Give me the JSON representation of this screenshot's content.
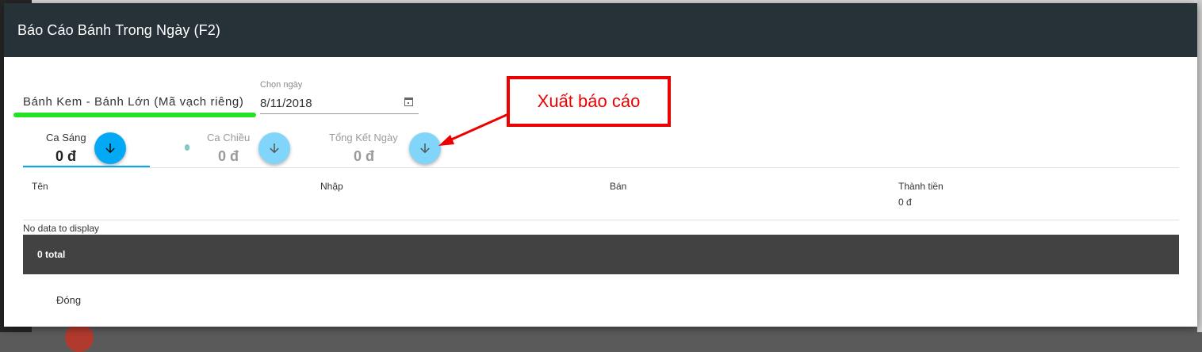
{
  "dialog": {
    "title": "Báo Cáo Bánh Trong Ngày (F2)"
  },
  "filters": {
    "product_group": "Bánh Kem - Bánh Lớn (Mã vạch riêng)",
    "date_label": "Chọn ngày",
    "date_value": "8/11/2018"
  },
  "shifts": [
    {
      "label": "Ca Sáng",
      "amount": "0 đ",
      "active": true
    },
    {
      "label": "Ca Chiều",
      "amount": "0 đ",
      "active": false
    },
    {
      "label": "Tổng Kết Ngày",
      "amount": "0 đ",
      "active": false
    }
  ],
  "table": {
    "columns": [
      "Tên",
      "Nhập",
      "Bán",
      "Thành tiền"
    ],
    "column_total": "0 đ",
    "empty_text": "No data to display",
    "footer": "0 total"
  },
  "actions": {
    "close_label": "Đóng"
  },
  "annotation": {
    "text": "Xuất báo cáo",
    "color": "#ee0000",
    "highlight_color": "#22e222"
  },
  "colors": {
    "header_bg": "#263238",
    "accent": "#03a9f4",
    "accent_light": "#81d4fa",
    "footer_bg": "#424242"
  }
}
